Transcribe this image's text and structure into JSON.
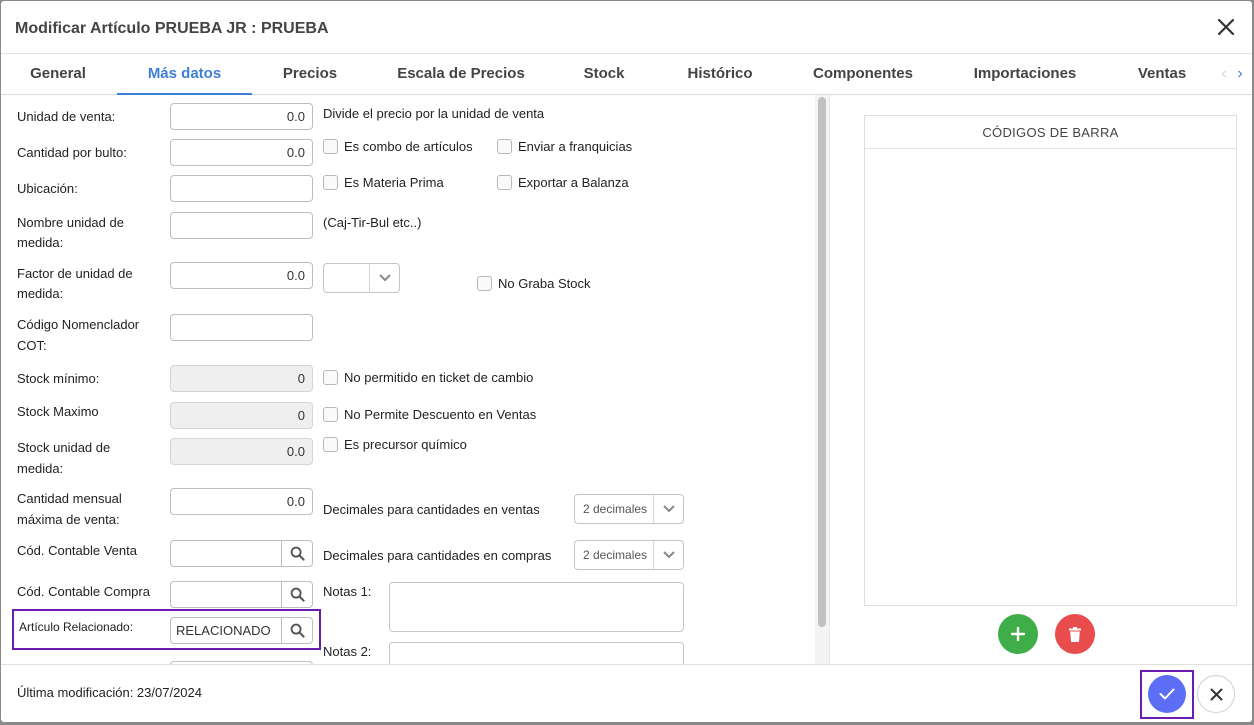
{
  "dialog": {
    "title": "Modificar Artículo PRUEBA JR : PRUEBA"
  },
  "tabs": [
    {
      "label": "General"
    },
    {
      "label": "Más datos"
    },
    {
      "label": "Precios"
    },
    {
      "label": "Escala de Precios"
    },
    {
      "label": "Stock"
    },
    {
      "label": "Histórico"
    },
    {
      "label": "Componentes"
    },
    {
      "label": "Importaciones"
    },
    {
      "label": "Ventas"
    }
  ],
  "form": {
    "unidad_venta": {
      "label": "Unidad de venta:",
      "value": "0.0",
      "hint": "Divide el precio por la unidad de venta"
    },
    "cantidad_bulto": {
      "label": "Cantidad por bulto:",
      "value": "0.0"
    },
    "ubicacion": {
      "label": "Ubicación:",
      "value": ""
    },
    "nombre_unidad": {
      "label1": "Nombre unidad de",
      "label2": "medida:",
      "value": "",
      "hint": "(Caj-Tir-Bul etc..)"
    },
    "factor_unidad": {
      "label1": "Factor de unidad de",
      "label2": "medida:",
      "value": "0.0",
      "select_value": ""
    },
    "codigo_cot": {
      "label1": "Código Nomenclador",
      "label2": "COT:",
      "value": ""
    },
    "stock_minimo": {
      "label": "Stock mínimo:",
      "value": "0"
    },
    "stock_maximo": {
      "label": "Stock Maximo",
      "value": "0"
    },
    "stock_unidad": {
      "label1": "Stock unidad de",
      "label2": "medida:",
      "value": "0.0"
    },
    "cantidad_mensual": {
      "label1": "Cantidad mensual",
      "label2": "máxima de venta:",
      "value": "0.0"
    },
    "cod_contable_venta": {
      "label": "Cód. Contable Venta",
      "value": ""
    },
    "cod_contable_compra": {
      "label": "Cód. Contable Compra",
      "value": ""
    },
    "articulo_relacionado": {
      "label": "Artículo Relacionado:",
      "value": "RELACIONADO"
    },
    "decimales_ventas": {
      "label": "Decimales para cantidades en ventas",
      "value": "2 decimales"
    },
    "decimales_compras": {
      "label": "Decimales para cantidades en compras",
      "value": "2 decimales"
    },
    "notas1": {
      "label": "Notas 1:"
    },
    "notas2": {
      "label": "Notas 2:"
    }
  },
  "checkboxes": {
    "combo": "Es combo de artículos",
    "franquicias": "Enviar a franquicias",
    "materia_prima": "Es Materia Prima",
    "balanza": "Exportar a Balanza",
    "no_graba_stock": "No Graba Stock",
    "ticket_cambio": "No permitido en ticket de cambio",
    "descuento": "No Permite Descuento en Ventas",
    "precursor": "Es precursor químico"
  },
  "barcodes": {
    "title": "CÓDIGOS DE BARRA"
  },
  "footer": {
    "last_modified": "Última modificación: 23/07/2024"
  },
  "colors": {
    "accent": "#3f7fd4",
    "add": "#3fae49",
    "delete": "#e84c4c",
    "confirm": "#5b6ef5",
    "highlight": "#6a1bb0"
  }
}
